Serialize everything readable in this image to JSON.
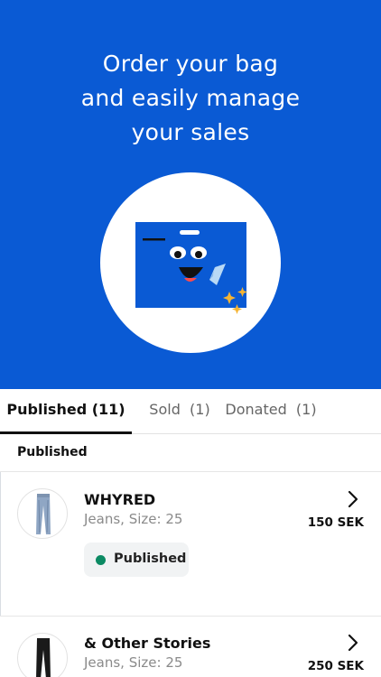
{
  "hero": {
    "title_line1": "Order your bag",
    "title_line2": "and easily manage",
    "title_line3": "your sales",
    "background_color": "#0a5ad4",
    "illustration": "smiling-bag-icon"
  },
  "tabs": [
    {
      "label": "Published (11)",
      "active": true
    },
    {
      "label": "Sold  (1)",
      "active": false
    },
    {
      "label": "Donated  (1)",
      "active": false
    }
  ],
  "section": {
    "label": "Published"
  },
  "items": [
    {
      "brand": "WHYRED",
      "subtitle": "Jeans, Size: 25",
      "price": "150 SEK",
      "status": "Published",
      "status_color": "#0b8a63",
      "thumbnail": "light-jeans-icon"
    },
    {
      "brand": "& Other Stories",
      "subtitle": "Jeans, Size: 25",
      "price": "250 SEK",
      "thumbnail": "black-jeans-icon"
    }
  ]
}
